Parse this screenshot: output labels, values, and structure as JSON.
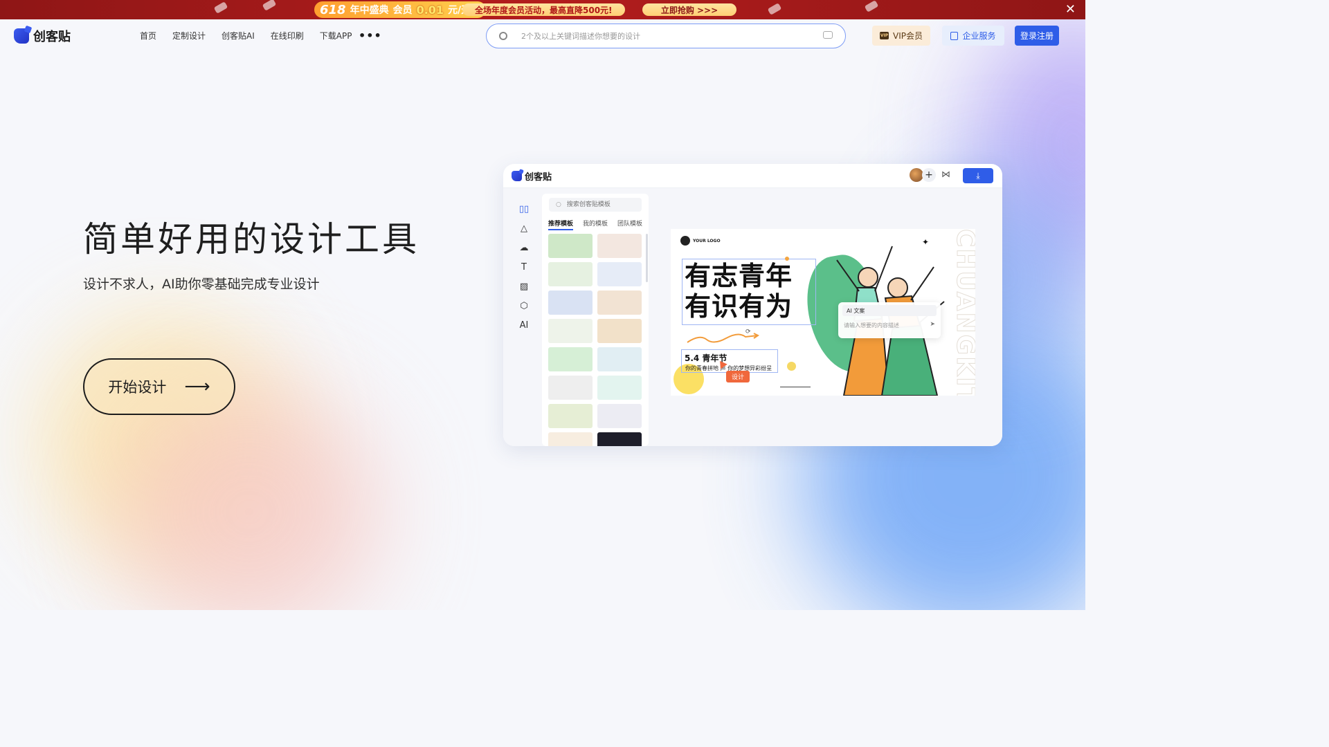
{
  "banner": {
    "promo1": {
      "big": "618",
      "part1": "年中盛典",
      "part2": "会员",
      "highlight": "0.01",
      "part3": "元/天起"
    },
    "promo2": "全场年度会员活动，最高直降500元!",
    "promo3": "立即抢购 >>>",
    "close": "✕"
  },
  "nav": {
    "brand": "创客贴",
    "menu": [
      "首页",
      "定制设计",
      "创客贴AI",
      "在线印刷",
      "下载APP"
    ],
    "more": "•••",
    "search_placeholder": "2个及以上关键词描述你想要的设计",
    "vip_label": "VIP会员",
    "vip_icon_text": "VIP",
    "biz_label": "企业服务",
    "login_label": "登录注册"
  },
  "hero": {
    "title": "简单好用的设计工具",
    "subtitle": "设计不求人，AI助你零基础完成专业设计",
    "cta_label": "开始设计",
    "cta_arrow": "⟶"
  },
  "mockup": {
    "brand": "创客贴",
    "plus": "+",
    "share": "⋈",
    "download": "⤓",
    "tools": [
      {
        "icon": "template-icon",
        "glyph": "▯▯",
        "active": true
      },
      {
        "icon": "shape-icon",
        "glyph": "△",
        "active": false
      },
      {
        "icon": "upload-icon",
        "glyph": "☁",
        "active": false
      },
      {
        "icon": "text-icon",
        "glyph": "T",
        "active": false
      },
      {
        "icon": "background-icon",
        "glyph": "▨",
        "active": false
      },
      {
        "icon": "3d-icon",
        "glyph": "⬡",
        "active": false
      },
      {
        "icon": "ai-icon",
        "glyph": "AI",
        "active": false
      }
    ],
    "panel": {
      "search_placeholder": "搜索创客贴模板",
      "tabs": [
        "推荐模板",
        "我的模板",
        "团队模板"
      ]
    },
    "thumb_colors": [
      "#cfe8c8",
      "#f3e7e0",
      "#e6f1e1",
      "#e6ecf7",
      "#d9e2f3",
      "#f2e3d3",
      "#eef3ea",
      "#f2e1c9",
      "#d6efd6",
      "#e1eef3",
      "#eeeeee",
      "#e3f4ef",
      "#e6eed5",
      "#ececf3",
      "#f7ede0",
      "#1e1e2a"
    ],
    "design": {
      "logo_text": "YOUR LOGO",
      "title_line1": "有志青年",
      "title_line2": "有识有为",
      "date": "5.4 青年节",
      "slogan": "你的青春拼地 声 你的梦想异彩纷呈",
      "vertical": "CHUANGKIT",
      "star": "✦",
      "rotate": "⟳",
      "design_button": "设计",
      "ai_title": "AI 文案",
      "ai_placeholder": "请输入想要的内容描述",
      "ai_send": "➤"
    }
  }
}
